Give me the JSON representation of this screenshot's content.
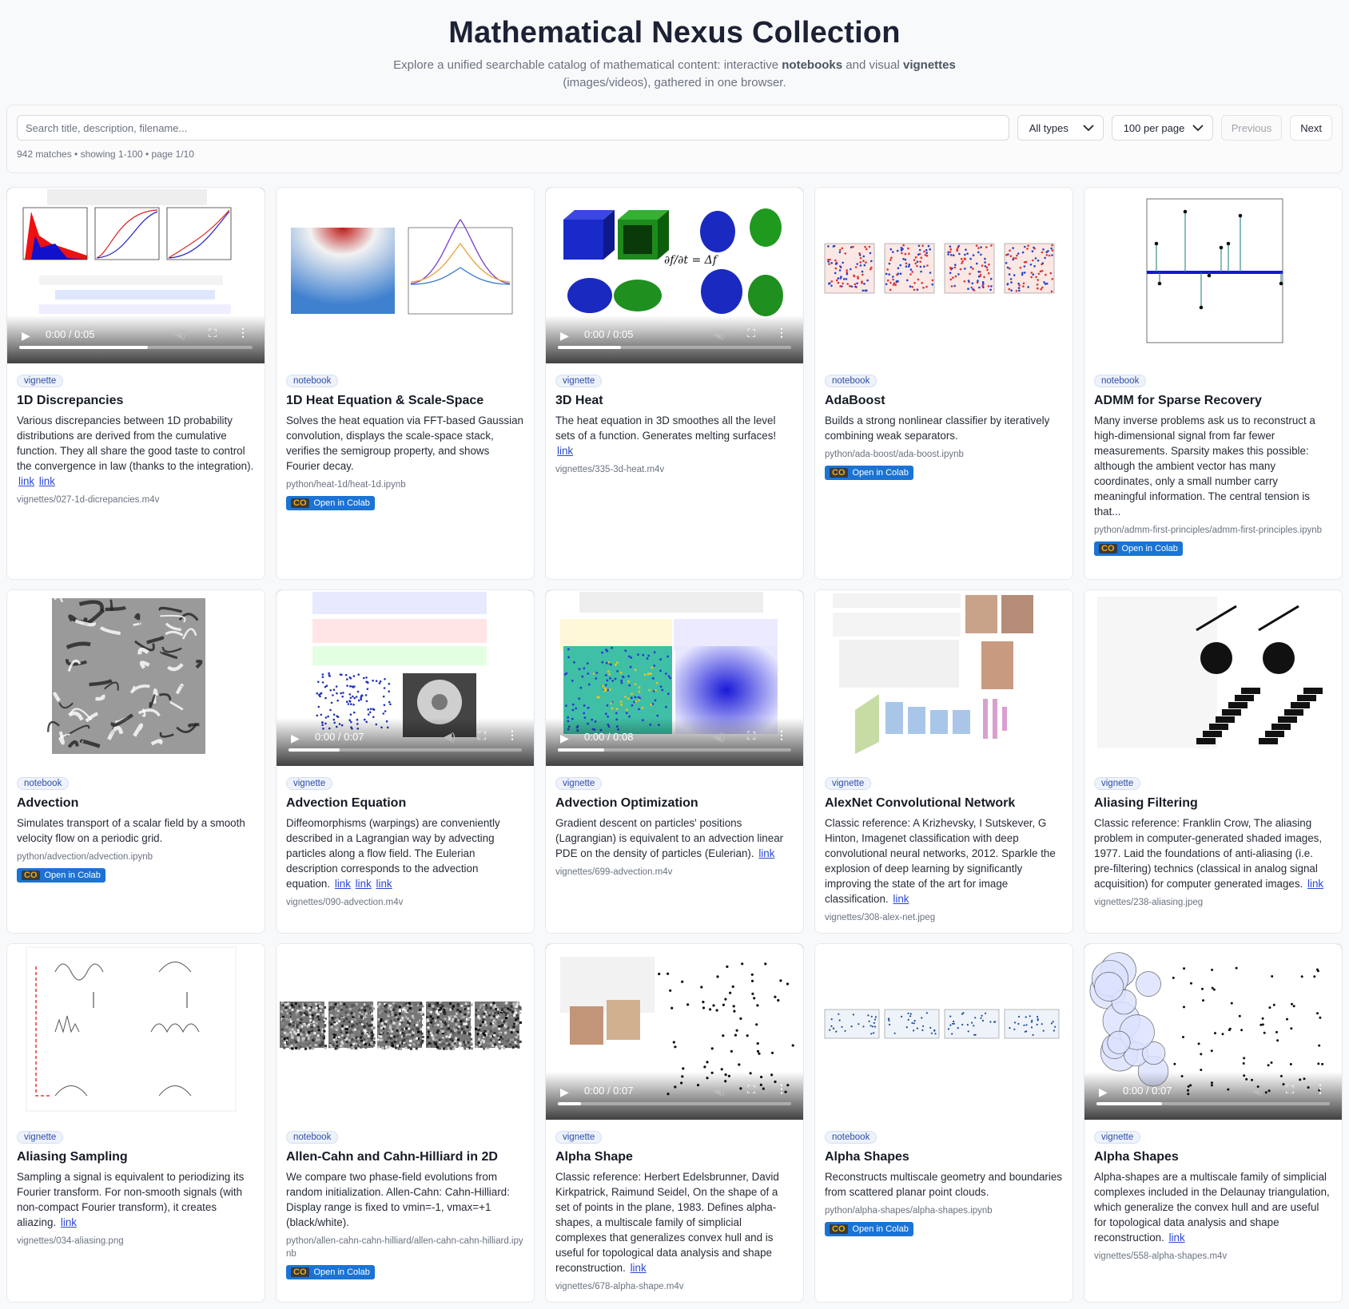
{
  "header": {
    "title": "Mathematical Nexus Collection",
    "subtitle_pre": "Explore a unified searchable catalog of mathematical content: interactive ",
    "subtitle_b1": "notebooks",
    "subtitle_mid": " and visual ",
    "subtitle_b2": "vignettes",
    "subtitle_post": " (images/videos), gathered in one browser."
  },
  "toolbar": {
    "search_placeholder": "Search title, description, filename...",
    "type_filter": "All types",
    "per_page": "100 per page",
    "prev": "Previous",
    "next": "Next",
    "meta": "942 matches • showing 1-100 • page 1/10"
  },
  "colab_label": "Open in Colab",
  "colab_logo": "CO",
  "link_text": "link",
  "colors": {
    "accent": "#2a47d6",
    "colab": "#1b73d4",
    "badge": "#eef2fb"
  },
  "cards": [
    {
      "type": "vignette",
      "title": "1D Discrepancies",
      "desc": "Various discrepancies between 1D probability distributions are derived from the cumulative function. They all share the good taste to control the convergence in law (thanks to the integration).",
      "links": 2,
      "file": "vignettes/027-1d-dicrepancies.m4v",
      "colab": false,
      "video": true,
      "time": "0:00 / 0:05",
      "progress": 0.55
    },
    {
      "type": "notebook",
      "title": "1D Heat Equation & Scale-Space",
      "desc": "Solves the heat equation via FFT-based Gaussian convolution, displays the scale-space stack, verifies the semigroup property, and shows Fourier decay.",
      "links": 0,
      "file": "python/heat-1d/heat-1d.ipynb",
      "colab": true,
      "video": false
    },
    {
      "type": "vignette",
      "title": "3D Heat",
      "desc": "The heat equation in 3D smoothes all the level sets of a function. Generates melting surfaces!",
      "links": 1,
      "file": "vignettes/335-3d-heat.m4v",
      "colab": false,
      "video": true,
      "time": "0:00 / 0:05",
      "progress": 0.27
    },
    {
      "type": "notebook",
      "title": "AdaBoost",
      "desc": "Builds a strong nonlinear classifier by iteratively combining weak separators.",
      "links": 0,
      "file": "python/ada-boost/ada-boost.ipynb",
      "colab": true,
      "video": false
    },
    {
      "type": "notebook",
      "title": "ADMM for Sparse Recovery",
      "desc": "Many inverse problems ask us to reconstruct a high-dimensional signal from far fewer measurements. Sparsity makes this possible: although the ambient vector has many coordinates, only a small number carry meaningful information. The central tension is that...",
      "links": 0,
      "file": "python/admm-first-principles/admm-first-principles.ipynb",
      "colab": true,
      "video": false
    },
    {
      "type": "notebook",
      "title": "Advection",
      "desc": "Simulates transport of a scalar field by a smooth velocity flow on a periodic grid.",
      "links": 0,
      "file": "python/advection/advection.ipynb",
      "colab": true,
      "video": false
    },
    {
      "type": "vignette",
      "title": "Advection Equation",
      "desc": "Diffeomorphisms (warpings) are conveniently described in a Lagrangian way by advecting particles along a flow field. The Eulerian description corresponds to the advection equation.",
      "links": 3,
      "file": "vignettes/090-advection.m4v",
      "colab": false,
      "video": true,
      "time": "0:00 / 0:07",
      "progress": 0.22
    },
    {
      "type": "vignette",
      "title": "Advection Optimization",
      "desc": "Gradient descent on particles' positions (Lagrangian) is equivalent to an advection linear PDE on the density of particles (Eulerian).",
      "links": 1,
      "file": "vignettes/699-advection.m4v",
      "colab": false,
      "video": true,
      "time": "0:00 / 0:08",
      "progress": 0.2
    },
    {
      "type": "vignette",
      "title": "AlexNet Convolutional Network",
      "desc": "Classic reference: A Krizhevsky, I Sutskever, G Hinton, Imagenet classification with deep convolutional neural networks, 2012. Sparkle the explosion of deep learning by significantly improving the state of the art for image classification.",
      "links": 1,
      "file": "vignettes/308-alex-net.jpeg",
      "colab": false,
      "video": false
    },
    {
      "type": "vignette",
      "title": "Aliasing Filtering",
      "desc": "Classic reference: Franklin Crow, The aliasing problem in computer-generated shaded images, 1977. Laid the foundations of anti-aliasing (i.e. pre-filtering) technics (classical in analog signal acquisition) for computer generated images.",
      "links": 1,
      "file": "vignettes/238-aliasing.jpeg",
      "colab": false,
      "video": false
    },
    {
      "type": "vignette",
      "title": "Aliasing Sampling",
      "desc": "Sampling a signal is equivalent to periodizing its Fourier transform. For non-smooth signals (with non-compact Fourier transform), it creates aliazing.",
      "links": 1,
      "file": "vignettes/034-aliasing.png",
      "colab": false,
      "video": false
    },
    {
      "type": "notebook",
      "title": "Allen-Cahn and Cahn-Hilliard in 2D",
      "desc": "We compare two phase-field evolutions from random initialization. Allen-Cahn: Cahn-Hilliard: Display range is fixed to vmin=-1, vmax=+1 (black/white).",
      "links": 0,
      "file": "python/allen-cahn-cahn-hilliard/allen-cahn-cahn-hilliard.ipynb",
      "colab": true,
      "video": false
    },
    {
      "type": "vignette",
      "title": "Alpha Shape",
      "desc": "Classic reference: Herbert Edelsbrunner, David Kirkpatrick, Raimund Seidel, On the shape of a set of points in the plane, 1983. Defines alpha-shapes, a multiscale family of simplicial complexes that generalizes convex hull and is useful for topological data analysis and shape reconstruction.",
      "links": 1,
      "file": "vignettes/678-alpha-shape.m4v",
      "colab": false,
      "video": true,
      "time": "0:00 / 0:07",
      "progress": 0.1
    },
    {
      "type": "notebook",
      "title": "Alpha Shapes",
      "desc": "Reconstructs multiscale geometry and boundaries from scattered planar point clouds.",
      "links": 0,
      "file": "python/alpha-shapes/alpha-shapes.ipynb",
      "colab": true,
      "video": false
    },
    {
      "type": "vignette",
      "title": "Alpha Shapes",
      "desc": "Alpha-shapes are a multiscale family of simplicial complexes included in the Delaunay triangulation, which generalize the convex hull and are useful for topological data analysis and shape reconstruction.",
      "links": 1,
      "file": "vignettes/558-alpha-shapes.m4v",
      "colab": false,
      "video": true,
      "time": "0:00 / 0:07",
      "progress": 0.28
    }
  ]
}
